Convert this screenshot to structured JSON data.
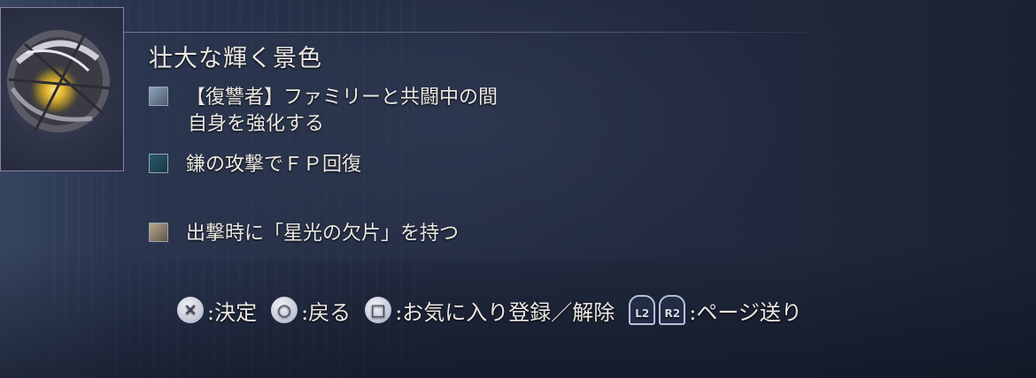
{
  "item": {
    "name": "壮大な輝く景色",
    "icon": "radiant-nest-relic-icon"
  },
  "effects": [
    {
      "icon": "avenger-plus-icon",
      "lines": [
        "【復讐者】ファミリーと共闘中の間",
        "自身を強化する"
      ]
    },
    {
      "icon": "scythe-fp-icon",
      "lines": [
        "鎌の攻撃でＦＰ回復"
      ]
    },
    {
      "icon": "starlight-shard-icon",
      "lines": [
        "出撃時に「星光の欠片」を持つ"
      ]
    }
  ],
  "controls": {
    "confirm": {
      "glyph": "✕",
      "label": ":決定"
    },
    "back": {
      "glyph": "○",
      "label": ":戻る"
    },
    "favorite": {
      "glyph": "□",
      "label": ":お気に入り登録／解除"
    },
    "page": {
      "l2": "L2",
      "r2": "R2",
      "label": ":ページ送り"
    }
  },
  "colors": {
    "accent_frame": "#8a7fa6",
    "text": "#ece9e4",
    "background": "#1b2234"
  }
}
